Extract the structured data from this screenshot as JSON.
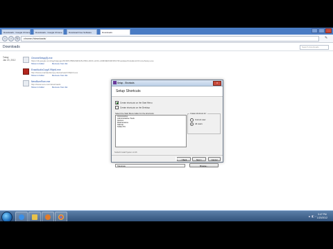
{
  "browser": {
    "tabs": [
      {
        "label": "Downloads - Google Chrome"
      },
      {
        "label": "Downloads - Google Chrome"
      },
      {
        "label": "Download Free Software"
      },
      {
        "label": "Downloads"
      }
    ],
    "address": "chrome://downloads/"
  },
  "downloads": {
    "title": "Downloads",
    "search_placeholder": "Search downloads",
    "date_label": "Today",
    "date_value": "Jan 20, 2012",
    "items": [
      {
        "name": "ChromeSetup(8).exe",
        "url": "https://dl.google.com/tag/s/appguid%3D%7B8A69D345-D564-463C-AFF1-A69D9E530F96%7D/update2/installers/ChromeSetup.exe",
        "show_label": "Show in folder",
        "remove_label": "Remove from list"
      },
      {
        "name": "ExactAudioCopy0.99pb4.exe",
        "url": "http://www.exactaudiocopy.de/eac/eac0.99pb4.exe",
        "show_label": "Show in folder",
        "remove_label": "Remove from list"
      },
      {
        "name": "NeroBurnRom.exe",
        "url": "http://www.nero.com/downloads",
        "show_label": "Show in folder",
        "remove_label": "Remove from list"
      }
    ]
  },
  "installer": {
    "window_title": "Setup - Shortcuts",
    "close_label": "X",
    "header_title": "Setup Shortcuts",
    "options": [
      {
        "label": "Create shortcuts on the Start Menu",
        "checked": true
      },
      {
        "label": "Create shortcuts on the Desktop",
        "checked": false
      }
    ],
    "list_label": "Select the Start Menu folder for the shortcuts:",
    "folders": [
      "Accessories",
      "Administrative Tools",
      "Games",
      "Maintenance",
      "Startup",
      "Tablet PC"
    ],
    "group_label": "Create shortcuts for:",
    "radios": [
      {
        "label": "Current user",
        "selected": false
      },
      {
        "label": "All users",
        "selected": true
      }
    ],
    "folder_value": "Shortcuts",
    "browse_label": "Browse...",
    "footer_text": "Nullsoft Install System v2.46",
    "back_label": "< Back",
    "next_label": "Next >",
    "cancel_label": "Cancel"
  },
  "taskbar": {
    "time": "3:47 PM",
    "date": "1/20/2012",
    "tray_icons": "▲ ◧ ♪"
  },
  "colors": {
    "tabstrip": "#4a7cc4",
    "taskbar": "#2f4f78",
    "link": "#1f4ea5"
  }
}
